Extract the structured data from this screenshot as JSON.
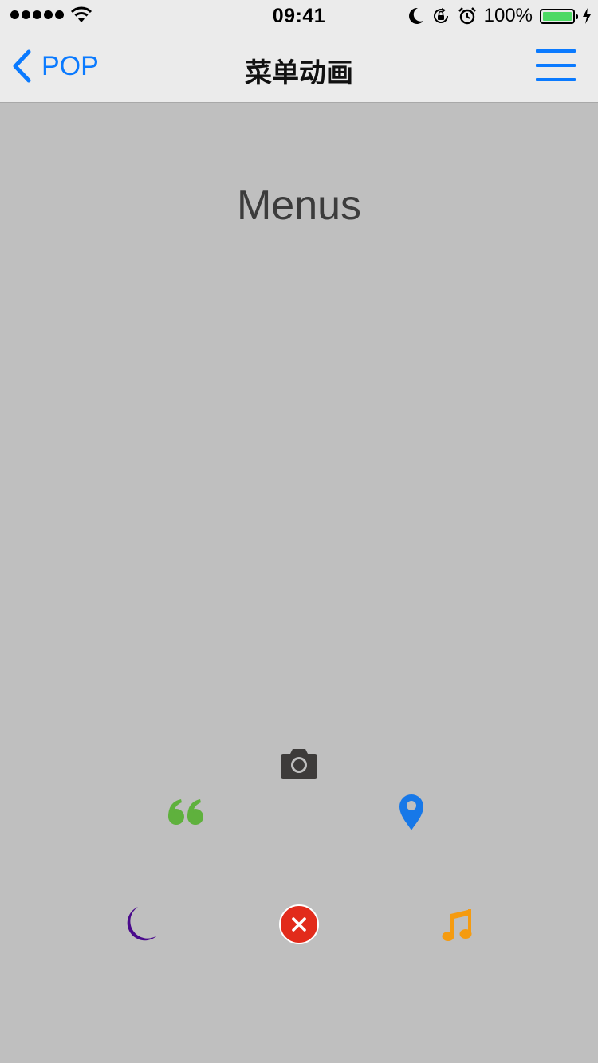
{
  "status_bar": {
    "time": "09:41",
    "battery_percent": "100%",
    "battery_level": 1.0,
    "icons": [
      "signal-dots",
      "wifi-icon",
      "moon-icon",
      "rotation-lock-icon",
      "alarm-icon",
      "battery-icon",
      "charging-icon"
    ]
  },
  "nav": {
    "back_label": "POP",
    "title": "菜单动画",
    "menu_icon": "hamburger-icon"
  },
  "content": {
    "heading": "Menus"
  },
  "menu_items": [
    {
      "name": "camera-icon",
      "color": "#3d3b3a"
    },
    {
      "name": "quote-icon",
      "color": "#5fb13d"
    },
    {
      "name": "location-pin-icon",
      "color": "#1778e8"
    },
    {
      "name": "moon-icon",
      "color": "#4a0a8c"
    },
    {
      "name": "close-icon",
      "color": "#e22b1b"
    },
    {
      "name": "music-note-icon",
      "color": "#f59b10"
    }
  ],
  "colors": {
    "accent": "#0a7aff",
    "background": "#bfbfbf",
    "bar_background": "#ebebeb"
  }
}
